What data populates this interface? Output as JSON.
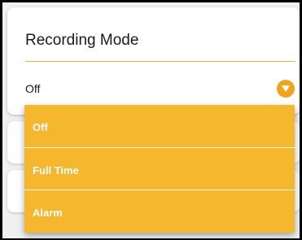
{
  "recording_mode": {
    "title": "Recording Mode",
    "selected_value": "Off",
    "options": [
      {
        "label": "Off"
      },
      {
        "label": "Full Time"
      },
      {
        "label": "Alarm"
      }
    ]
  },
  "colors": {
    "accent": "#f5b72e",
    "icon": "#f0a31e",
    "divider": "#f0b62c"
  },
  "icons": {
    "dropdown": "chevron-down-icon"
  }
}
